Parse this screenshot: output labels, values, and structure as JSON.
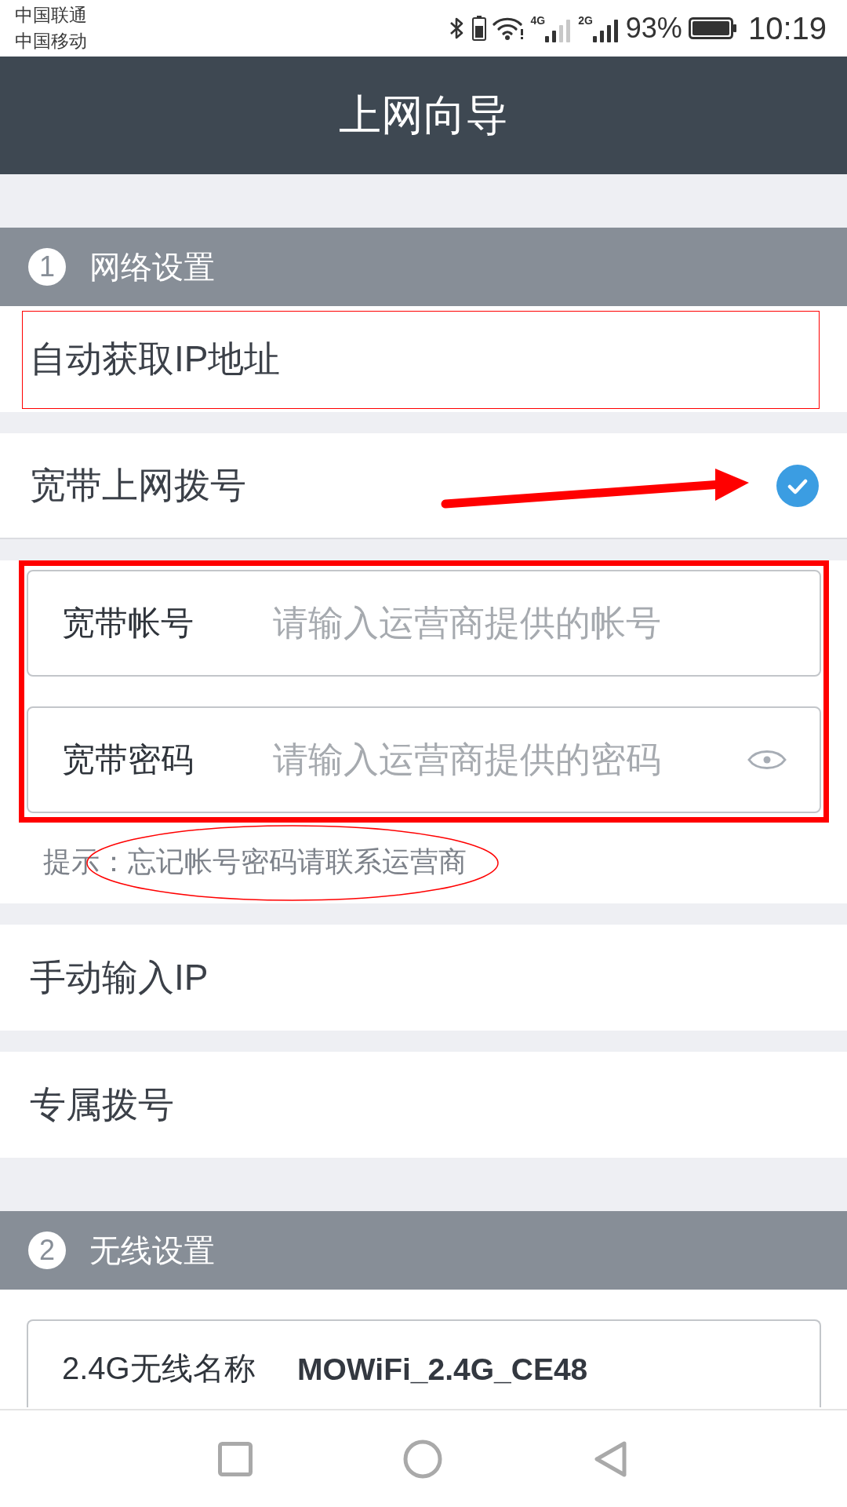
{
  "status_bar": {
    "carriers": [
      "中国联通",
      "中国移动"
    ],
    "networks": [
      "4G",
      "2G"
    ],
    "battery": "93%",
    "time": "10:19"
  },
  "header": {
    "title": "上网向导"
  },
  "sections": [
    {
      "number": "1",
      "title": "网络设置",
      "options": [
        {
          "label": "自动获取IP地址",
          "selected": false,
          "framed": true
        },
        {
          "label": "宽带上网拨号",
          "selected": true,
          "arrow": true,
          "details": {
            "framed": true,
            "fields": [
              {
                "kind": "text",
                "label": "宽带帐号",
                "placeholder": "请输入运营商提供的帐号"
              },
              {
                "kind": "password",
                "label": "宽带密码",
                "placeholder": "请输入运营商提供的密码"
              }
            ],
            "hint": {
              "text": "提示：忘记帐号密码请联系运营商",
              "circled": true
            }
          }
        },
        {
          "label": "手动输入IP",
          "selected": false
        },
        {
          "label": "专属拨号",
          "selected": false
        }
      ]
    },
    {
      "number": "2",
      "title": "无线设置",
      "fields": [
        {
          "kind": "text",
          "label": "2.4G无线名称",
          "value": "MOWiFi_2.4G_CE48"
        }
      ]
    }
  ]
}
